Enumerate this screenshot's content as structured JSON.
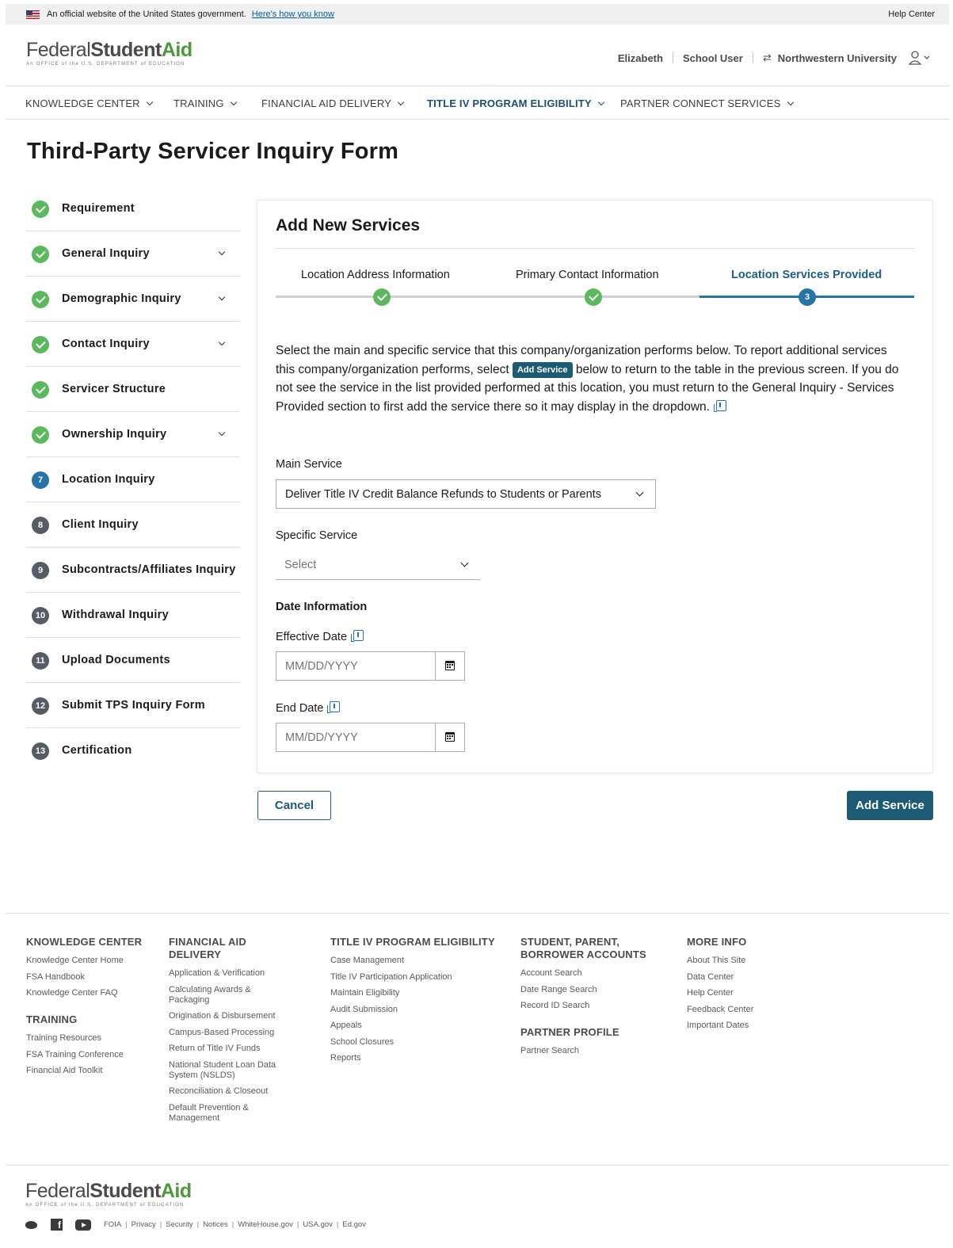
{
  "gov_banner": {
    "text": "An official website of the United States government.",
    "link": "Here's how you know",
    "help": "Help Center"
  },
  "logo": {
    "federal": "Federal",
    "student": "Student",
    "aid": "Aid",
    "sub": "An OFFICE of the U.S. DEPARTMENT of EDUCATION"
  },
  "user": {
    "name": "Elizabeth",
    "role": "School User",
    "school": "Northwestern University"
  },
  "nav": [
    {
      "label": "KNOWLEDGE CENTER"
    },
    {
      "label": "TRAINING"
    },
    {
      "label": "FINANCIAL AID DELIVERY"
    },
    {
      "label": "TITLE IV PROGRAM ELIGIBILITY"
    },
    {
      "label": "PARTNER CONNECT SERVICES"
    }
  ],
  "page_title": "Third-Party Servicer Inquiry Form",
  "sidebar": [
    {
      "label": "Requirement",
      "status": "done",
      "num": ""
    },
    {
      "label": "General Inquiry",
      "status": "done",
      "num": ""
    },
    {
      "label": "Demographic Inquiry",
      "status": "done",
      "num": ""
    },
    {
      "label": "Contact Inquiry",
      "status": "done",
      "num": ""
    },
    {
      "label": "Servicer Structure",
      "status": "done",
      "num": ""
    },
    {
      "label": "Ownership Inquiry",
      "status": "done",
      "num": ""
    },
    {
      "label": "Location Inquiry",
      "status": "current",
      "num": "7"
    },
    {
      "label": "Client Inquiry",
      "status": "todo",
      "num": "8"
    },
    {
      "label": "Subcontracts/Affiliates Inquiry",
      "status": "todo",
      "num": "9"
    },
    {
      "label": "Withdrawal Inquiry",
      "status": "todo",
      "num": "10"
    },
    {
      "label": "Upload Documents",
      "status": "todo",
      "num": "11"
    },
    {
      "label": "Submit TPS Inquiry Form",
      "status": "todo",
      "num": "12"
    },
    {
      "label": "Certification",
      "status": "todo",
      "num": "13"
    }
  ],
  "card": {
    "title": "Add New Services",
    "steps": [
      {
        "label": "Location Address Information",
        "status": "done",
        "num": ""
      },
      {
        "label": "Primary Contact Information",
        "status": "done",
        "num": ""
      },
      {
        "label": "Location Services Provided",
        "status": "current",
        "num": "3"
      }
    ],
    "instructions": {
      "part1": "Select the main and specific service that this company/organization performs below.  To report additional services this company/organization performs, select ",
      "button": "Add Service",
      "part2": " below to return to the table in the previous screen.  If you do not see the service in the list provided performed at this location, you must return to the General Inquiry - Services Provided section to first add the service there so it may display in the dropdown."
    },
    "main_service_label": "Main Service",
    "main_service_value": "Deliver Title IV Credit Balance Refunds to Students or Parents",
    "specific_service_label": "Specific Service",
    "specific_service_placeholder": "Select",
    "date_info_label": "Date Information",
    "effective_date_label": "Effective Date",
    "effective_date_placeholder": "MM/DD/YYYY",
    "end_date_label": "End Date",
    "end_date_placeholder": "MM/DD/YYYY"
  },
  "buttons": {
    "cancel": "Cancel",
    "add": "Add Service"
  },
  "footer": {
    "columns": [
      {
        "sections": [
          {
            "heading": "KNOWLEDGE CENTER",
            "links": [
              "Knowledge Center Home",
              "FSA Handbook",
              "Knowledge Center FAQ"
            ]
          },
          {
            "heading": "TRAINING",
            "links": [
              "Training Resources",
              "FSA Training Conference",
              "Financial Aid Toolkit"
            ]
          }
        ]
      },
      {
        "sections": [
          {
            "heading": "FINANCIAL AID DELIVERY",
            "links": [
              "Application & Verification",
              "Calculating Awards & Packaging",
              "Origination & Disbursement",
              "Campus-Based Processing",
              "Return of Title IV Funds",
              "National Student Loan Data System (NSLDS)",
              "Reconciliation & Closeout",
              "Default Prevention & Management"
            ]
          }
        ]
      },
      {
        "sections": [
          {
            "heading": "TITLE IV PROGRAM ELIGIBILITY",
            "links": [
              "Case Management",
              "Title IV Participation Application",
              "Maintain Eligibility",
              "Audit Submission",
              "Appeals",
              "School Closures",
              "Reports"
            ]
          }
        ]
      },
      {
        "sections": [
          {
            "heading": "STUDENT, PARENT, BORROWER ACCOUNTS",
            "links": [
              "Account Search",
              "Date Range Search",
              "Record ID Search"
            ]
          },
          {
            "heading": "PARTNER PROFILE",
            "links": [
              "Partner Search"
            ]
          }
        ]
      },
      {
        "sections": [
          {
            "heading": "MORE INFO",
            "links": [
              "About This Site",
              "Data Center",
              "Help Center",
              "Feedback Center",
              "Important Dates"
            ]
          }
        ]
      }
    ],
    "legal": [
      "FOIA",
      "Privacy",
      "Security",
      "Notices",
      "WhiteHouse.gov",
      "USA.gov",
      "Ed.gov"
    ]
  },
  "colors": {
    "accent": "#1d5a74",
    "success": "#5cb85c",
    "current": "#2674a6",
    "brand_green": "#4a9a3b"
  }
}
